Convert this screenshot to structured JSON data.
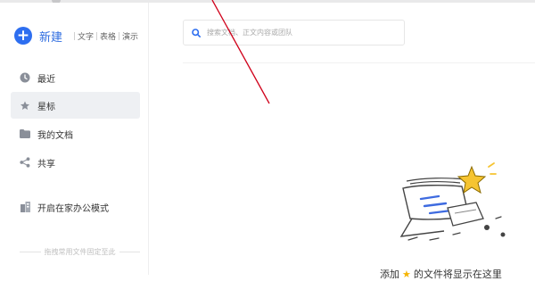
{
  "sidebar": {
    "new_label": "新建",
    "new_types": [
      "文字",
      "表格",
      "演示"
    ],
    "items": [
      {
        "label": "最近",
        "icon": "clock-icon"
      },
      {
        "label": "星标",
        "icon": "star-icon",
        "active": true
      },
      {
        "label": "我的文档",
        "icon": "folder-icon"
      },
      {
        "label": "共享",
        "icon": "share-icon"
      },
      {
        "label": "开启在家办公模式",
        "icon": "building-icon"
      }
    ],
    "drag_hint": "拖拽常用文件固定至此"
  },
  "search": {
    "placeholder": "搜索文档、正文内容或团队"
  },
  "empty_state": {
    "text_before": "添加",
    "text_after": "的文件将显示在这里"
  },
  "colors": {
    "accent": "#2d6ef0",
    "star": "#f5b400",
    "annotation": "#d0021b"
  }
}
